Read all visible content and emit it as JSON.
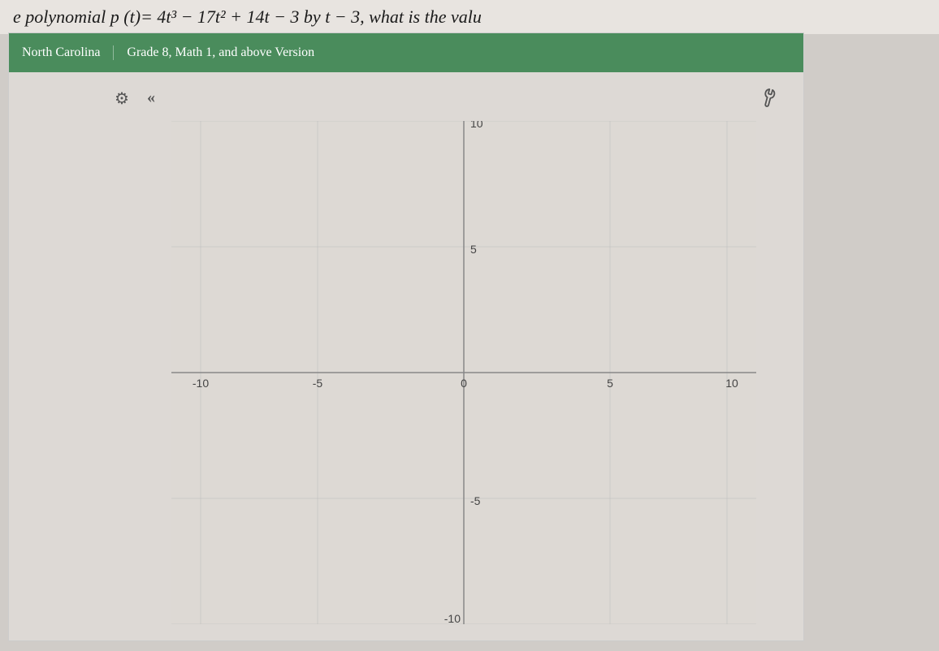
{
  "question": {
    "text": "e polynomial p (t)= 4t³ − 17t² + 14t − 3 by t − 3, what is the valu"
  },
  "header": {
    "region": "North Carolina",
    "grade": "Grade 8, Math 1, and above Version"
  },
  "graph": {
    "x_min": -10,
    "x_max": 10,
    "y_min": -10,
    "y_max": 10,
    "x_labels": [
      "-10",
      "-5",
      "0",
      "5",
      "10"
    ],
    "y_labels": [
      "10",
      "5",
      "-5",
      "-10"
    ],
    "gear_label": "⚙",
    "chevron_label": "«",
    "wrench_label": "🔧"
  },
  "toolbar": {
    "gear_title": "Settings",
    "chevron_title": "Collapse",
    "wrench_title": "Tools"
  }
}
